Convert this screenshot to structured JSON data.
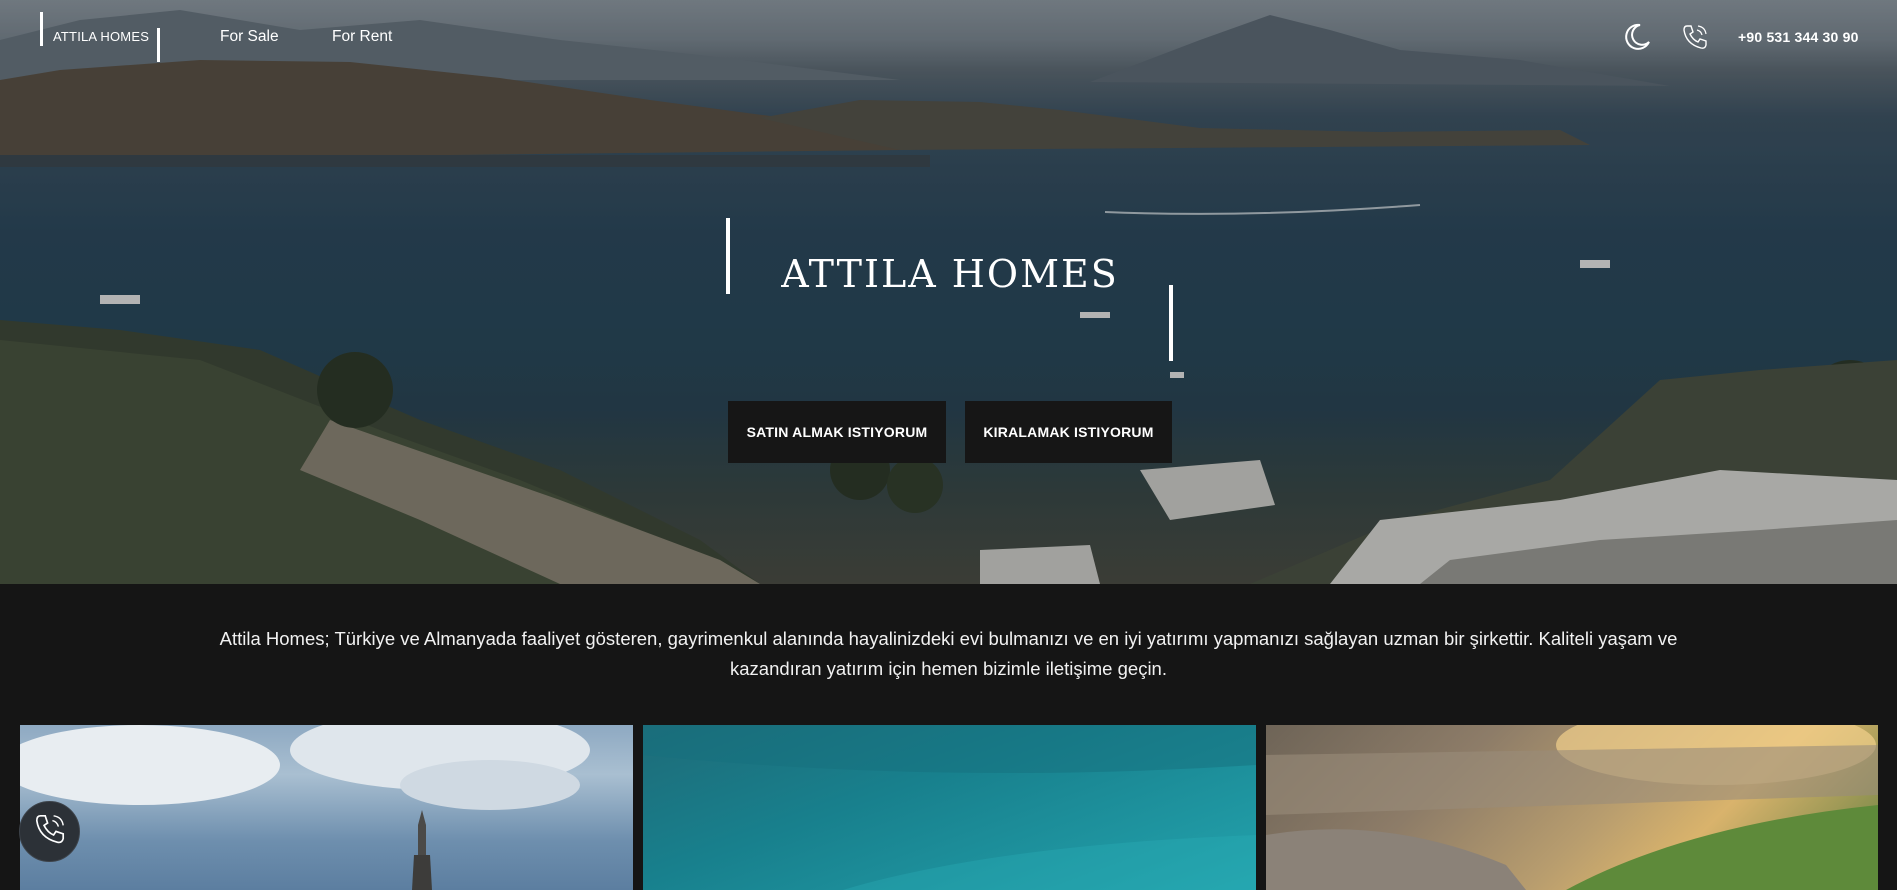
{
  "nav": {
    "logo": "ATTILA HOMES",
    "links": [
      "For Sale",
      "For Rent"
    ],
    "icons": [
      "moon-icon",
      "phone-icon"
    ],
    "phone": "+90 531 344 30 90"
  },
  "hero": {
    "title": "ATTILA HOMES",
    "buttons": [
      "SATIN ALMAK ISTIYORUM",
      "KIRALAMAK ISTIYORUM"
    ]
  },
  "intro": {
    "text": "Attila Homes; Türkiye ve Almanyada faaliyet gösteren, gayrimenkul alanında hayalinizdeki evi bulmanızı ve en iyi yatırımı yapmanızı sağlayan uzman bir şirkettir. Kaliteli yaşam ve kazandıran yatırım için hemen bizimle iletişime geçin."
  },
  "floating": {
    "icon": "phone-icon"
  },
  "colors": {
    "page_bg": "#151515",
    "button_bg": "#161616",
    "text": "#ffffff"
  }
}
